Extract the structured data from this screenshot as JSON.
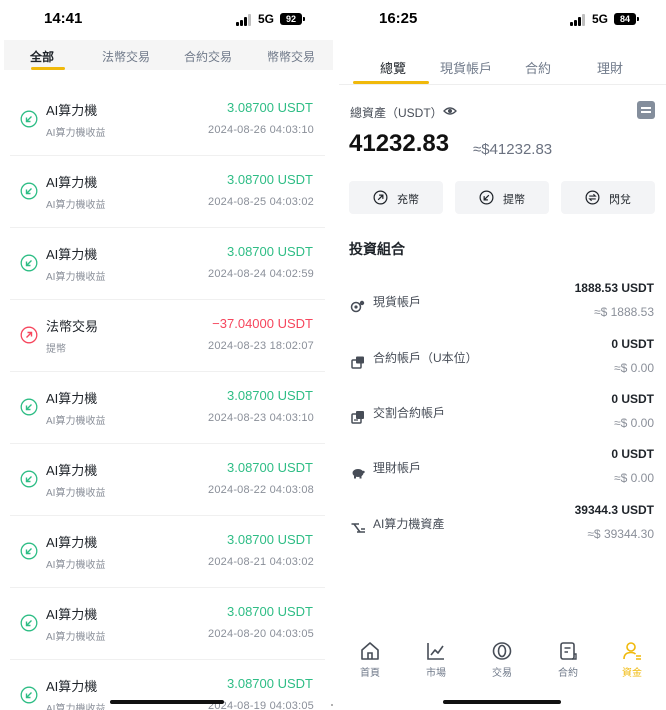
{
  "left": {
    "status": {
      "time": "14:41",
      "network": "5G",
      "battery": "92"
    },
    "tabs": [
      "全部",
      "法幣交易",
      "合約交易",
      "幣幣交易"
    ],
    "active_tab": 0,
    "transactions": [
      {
        "name": "AI算力機",
        "sub": "AI算力機收益",
        "amount": "3.08700 USDT",
        "date": "2024-08-26 04:03:10",
        "direction": "in",
        "icon": "arrow-in-icon"
      },
      {
        "name": "AI算力機",
        "sub": "AI算力機收益",
        "amount": "3.08700 USDT",
        "date": "2024-08-25 04:03:02",
        "direction": "in",
        "icon": "arrow-in-icon"
      },
      {
        "name": "AI算力機",
        "sub": "AI算力機收益",
        "amount": "3.08700 USDT",
        "date": "2024-08-24 04:02:59",
        "direction": "in",
        "icon": "arrow-in-icon"
      },
      {
        "name": "法幣交易",
        "sub": "提幣",
        "amount": "−37.04000 USDT",
        "date": "2024-08-23 18:02:07",
        "direction": "out",
        "icon": "arrow-out-icon"
      },
      {
        "name": "AI算力機",
        "sub": "AI算力機收益",
        "amount": "3.08700 USDT",
        "date": "2024-08-23 04:03:10",
        "direction": "in",
        "icon": "arrow-in-icon"
      },
      {
        "name": "AI算力機",
        "sub": "AI算力機收益",
        "amount": "3.08700 USDT",
        "date": "2024-08-22 04:03:08",
        "direction": "in",
        "icon": "arrow-in-icon"
      },
      {
        "name": "AI算力機",
        "sub": "AI算力機收益",
        "amount": "3.08700 USDT",
        "date": "2024-08-21 04:03:02",
        "direction": "in",
        "icon": "arrow-in-icon"
      },
      {
        "name": "AI算力機",
        "sub": "AI算力機收益",
        "amount": "3.08700 USDT",
        "date": "2024-08-20 04:03:05",
        "direction": "in",
        "icon": "arrow-in-icon"
      },
      {
        "name": "AI算力機",
        "sub": "AI算力機收益",
        "amount": "3.08700 USDT",
        "date": "2024-08-19 04:03:05",
        "direction": "in",
        "icon": "arrow-in-icon"
      }
    ]
  },
  "right": {
    "status": {
      "time": "16:25",
      "network": "5G",
      "battery": "84"
    },
    "tabs": [
      "總覽",
      "現貨帳戶",
      "合約",
      "理財"
    ],
    "active_tab": 0,
    "total_label": "總資產（USDT）",
    "total_value": "41232.83",
    "total_fiat": "≈$41232.83",
    "actions": [
      {
        "label": "充幣",
        "icon": "deposit-icon"
      },
      {
        "label": "提幣",
        "icon": "withdraw-icon"
      },
      {
        "label": "閃兌",
        "icon": "swap-icon"
      }
    ],
    "portfolio_title": "投資組合",
    "accounts": [
      {
        "name": "現貨帳戶",
        "value": "1888.53 USDT",
        "fiat": "≈$ 1888.53",
        "icon": "spot-icon"
      },
      {
        "name": "合約帳戶（U本位）",
        "value": "0 USDT",
        "fiat": "≈$ 0.00",
        "icon": "futures-icon"
      },
      {
        "name": "交割合約帳戶",
        "value": "0 USDT",
        "fiat": "≈$ 0.00",
        "icon": "delivery-icon"
      },
      {
        "name": "理財帳戶",
        "value": "0 USDT",
        "fiat": "≈$ 0.00",
        "icon": "piggy-bank-icon"
      },
      {
        "name": "AI算力機資產",
        "value": "39344.3 USDT",
        "fiat": "≈$ 39344.30",
        "icon": "mining-icon"
      }
    ],
    "nav": [
      {
        "label": "首頁",
        "icon": "home-icon"
      },
      {
        "label": "市場",
        "icon": "market-chart-icon"
      },
      {
        "label": "交易",
        "icon": "trade-icon"
      },
      {
        "label": "合約",
        "icon": "contract-icon"
      },
      {
        "label": "資金",
        "icon": "assets-icon"
      }
    ],
    "nav_active": 4
  },
  "colors": {
    "accent": "#f0b90b",
    "positive": "#2ebd85",
    "negative": "#f6465d"
  }
}
